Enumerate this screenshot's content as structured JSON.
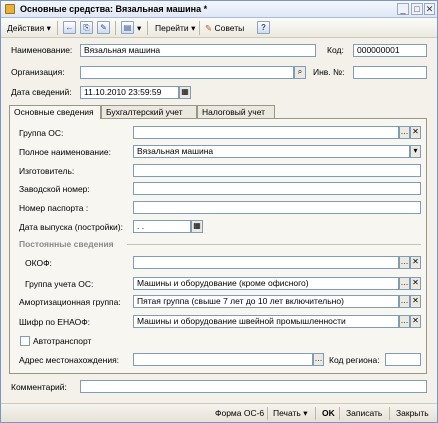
{
  "window": {
    "title": "Основные средства: Вязальная машина *"
  },
  "toolbar": {
    "actions_label": "Действия",
    "goto_label": "Перейти",
    "tips_label": "Советы",
    "help_label": "?"
  },
  "header": {
    "name_label": "Наименование:",
    "name_value": "Вязальная машина",
    "code_label": "Код:",
    "code_value": "000000001",
    "org_label": "Организация:",
    "org_value": "",
    "inv_label": "Инв. №:",
    "inv_value": "",
    "date_label": "Дата сведений:",
    "date_value": "11.10.2010 23:59:59"
  },
  "tabs": [
    {
      "label": "Основные сведения"
    },
    {
      "label": "Бухгалтерский учет"
    },
    {
      "label": "Налоговый учет"
    }
  ],
  "main": {
    "group_label": "Группа ОС:",
    "group_value": "",
    "fullname_label": "Полное наименование:",
    "fullname_value": "Вязальная машина",
    "maker_label": "Изготовитель:",
    "maker_value": "",
    "serial_label": "Заводской номер:",
    "serial_value": "",
    "passport_label": "Номер паспорта :",
    "passport_value": "",
    "release_label": "Дата выпуска (постройки):",
    "release_value": "  .  .",
    "section_title": "Постоянные сведения",
    "okof_label": "ОКОФ:",
    "okof_value": "",
    "account_group_label": "Группа учета ОС:",
    "account_group_value": "Машины и оборудование (кроме офисного)",
    "amort_label": "Амортизационная группа:",
    "amort_value": "Пятая группа (свыше 7 лет до 10 лет включительно)",
    "enaof_label": "Шифр по ЕНАОФ:",
    "enaof_value": "Машины и оборудование швейной промышленности",
    "auto_label": "Автотранспорт",
    "address_label": "Адрес местонахождения:",
    "address_value": "",
    "region_label": "Код региона:",
    "region_value": ""
  },
  "comment": {
    "label": "Комментарий:",
    "value": ""
  },
  "footer": {
    "form_label": "Форма ОС-6",
    "print_label": "Печать",
    "ok_label": "OK",
    "save_label": "Записать",
    "close_label": "Закрыть"
  },
  "icons": {
    "dropdown": "▾",
    "ellipsis": "...",
    "clear": "✕",
    "search": "🔍",
    "calendar": "▦"
  }
}
